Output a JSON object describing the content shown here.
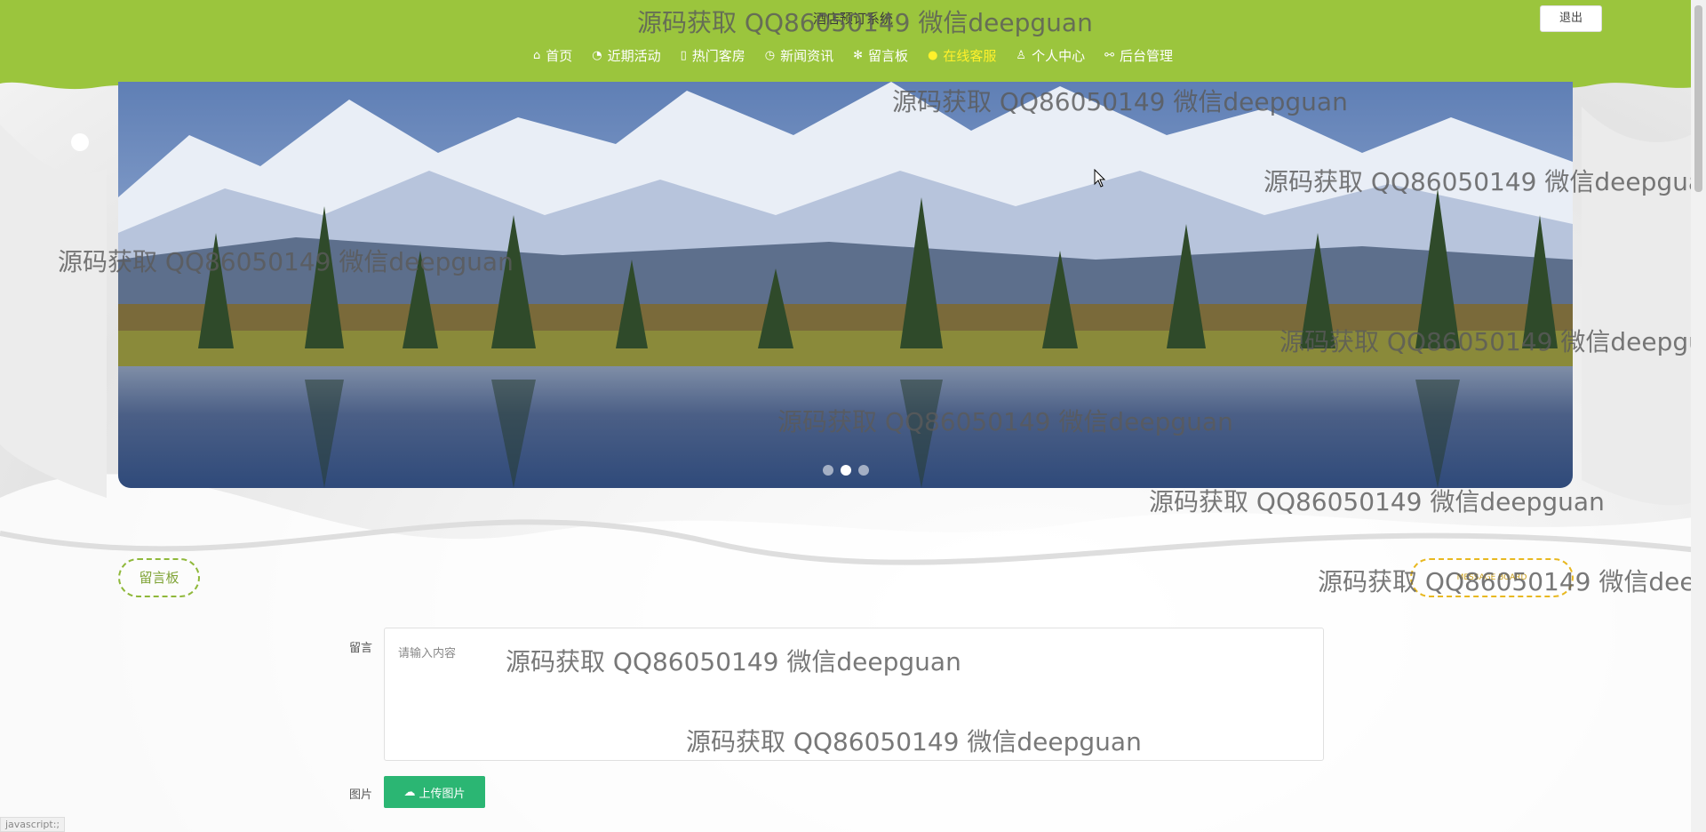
{
  "site": {
    "title": "酒店预订系统"
  },
  "header": {
    "logout_label": "退出",
    "nav": [
      {
        "label": "首页",
        "icon": "home-icon"
      },
      {
        "label": "近期活动",
        "icon": "gauge-icon"
      },
      {
        "label": "热门客房",
        "icon": "bookmark-icon"
      },
      {
        "label": "新闻资讯",
        "icon": "clock-icon"
      },
      {
        "label": "留言板",
        "icon": "snowflake-icon"
      },
      {
        "label": "在线客服",
        "icon": "chat-icon",
        "active": true
      },
      {
        "label": "个人中心",
        "icon": "user-icon"
      },
      {
        "label": "后台管理",
        "icon": "link-icon"
      }
    ],
    "active_color": "#fff12b",
    "bar_color": "#9bc53d"
  },
  "banner": {
    "slide_count": 3,
    "active_slide": 2
  },
  "section": {
    "left_pill": "留言板",
    "right_pill": "MESSAGE BOARD"
  },
  "form": {
    "message_label": "留言",
    "message_placeholder": "请输入内容",
    "image_label": "图片",
    "upload_label": "上传图片"
  },
  "watermark": "源码获取 QQ86050149 微信deepguan",
  "status_bar": "javascript:;"
}
